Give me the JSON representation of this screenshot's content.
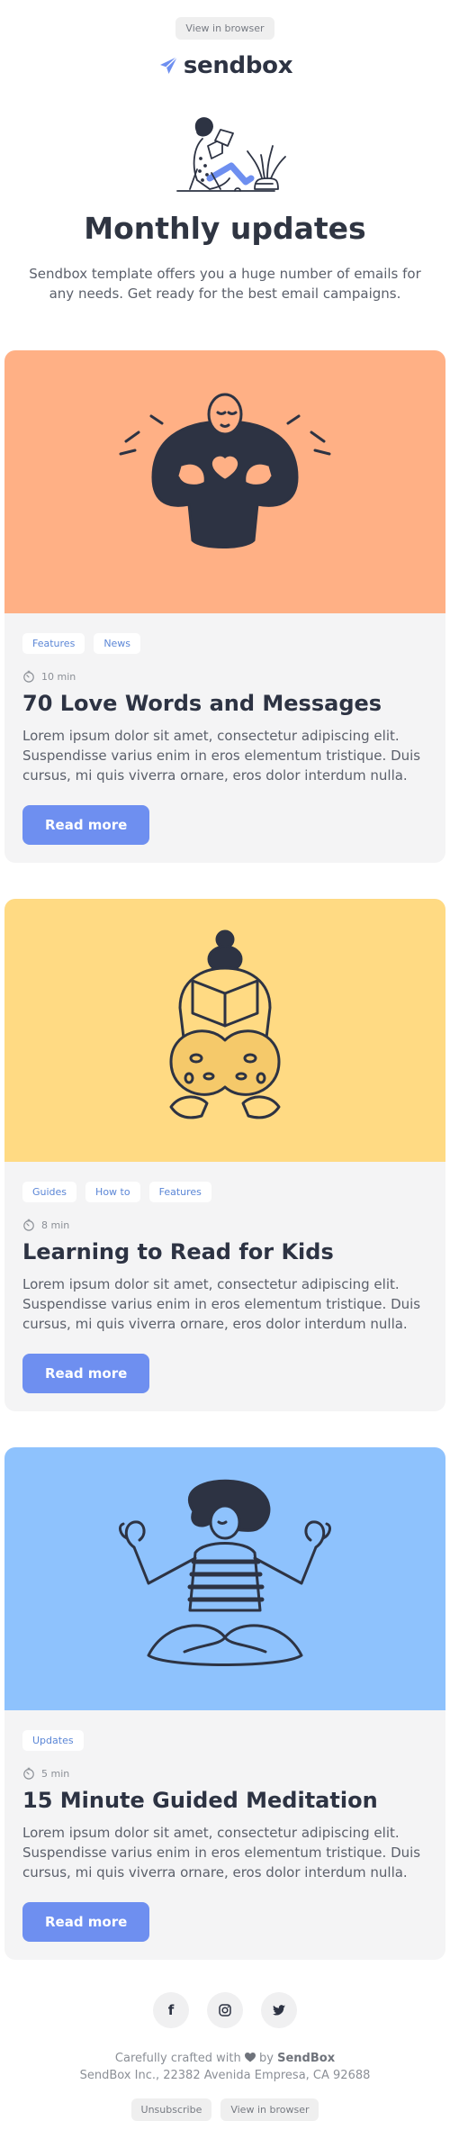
{
  "header": {
    "view_in_browser": "View in browser",
    "logo_text": "sendbox",
    "accent_color": "#6e8ff0"
  },
  "hero": {
    "title": "Monthly updates",
    "subtitle": "Sendbox template offers you a huge number of emails for any needs. Get ready for the best email campaigns."
  },
  "articles": [
    {
      "image_bg": "#ffb085",
      "illustration": "heart-hands-person-icon",
      "tags": [
        "Features",
        "News"
      ],
      "read_time": "10 min",
      "title": "70 Love Words and Messages",
      "text": "Lorem ipsum dolor sit amet, consectetur adipiscing elit. Suspendisse varius enim in eros elementum tristique. Duis cursus, mi quis viverra ornare, eros dolor interdum nulla.",
      "button": "Read more"
    },
    {
      "image_bg": "#ffda83",
      "illustration": "reading-kid-icon",
      "tags": [
        "Guides",
        "How to",
        "Features"
      ],
      "read_time": "8 min",
      "title": "Learning to Read for Kids",
      "text": "Lorem ipsum dolor sit amet, consectetur adipiscing elit. Suspendisse varius enim in eros elementum tristique. Duis cursus, mi quis viverra ornare, eros dolor interdum nulla.",
      "button": "Read more"
    },
    {
      "image_bg": "#8ec2fd",
      "illustration": "meditating-person-icon",
      "tags": [
        "Updates"
      ],
      "read_time": "5 min",
      "title": "15 Minute Guided Meditation",
      "text": "Lorem ipsum dolor sit amet, consectetur adipiscing elit. Suspendisse varius enim in eros elementum tristique. Duis cursus, mi quis viverra ornare, eros dolor interdum nulla.",
      "button": "Read more"
    }
  ],
  "footer": {
    "social": [
      "facebook-icon",
      "instagram-icon",
      "twitter-icon"
    ],
    "credit_prefix": "Carefully crafted with",
    "credit_by": "by",
    "brand": "SendBox",
    "address": "SendBox Inc., 22382 Avenida Empresa, CA 92688",
    "unsubscribe": "Unsubscribe",
    "view_in_browser": "View in browser"
  }
}
